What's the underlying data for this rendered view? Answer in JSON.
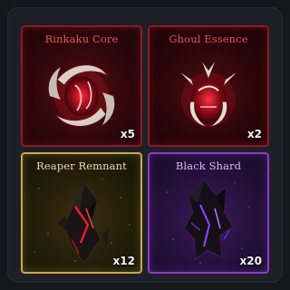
{
  "inventory": {
    "items": [
      {
        "name": "Rinkaku Core",
        "count": "x5",
        "rarity": "legendary-red",
        "icon": "rinkaku-core-icon"
      },
      {
        "name": "Ghoul Essence",
        "count": "x2",
        "rarity": "legendary-red",
        "icon": "ghoul-essence-icon"
      },
      {
        "name": "Reaper Remnant",
        "count": "x12",
        "rarity": "gold",
        "icon": "reaper-remnant-icon"
      },
      {
        "name": "Black Shard",
        "count": "x20",
        "rarity": "purple",
        "icon": "black-shard-icon"
      }
    ]
  },
  "colors": {
    "background": "#16171c",
    "panel": "#1f2027",
    "red_border": "#8a1a24",
    "gold_border": "#c9a94a",
    "purple_border": "#8a3cc8"
  }
}
